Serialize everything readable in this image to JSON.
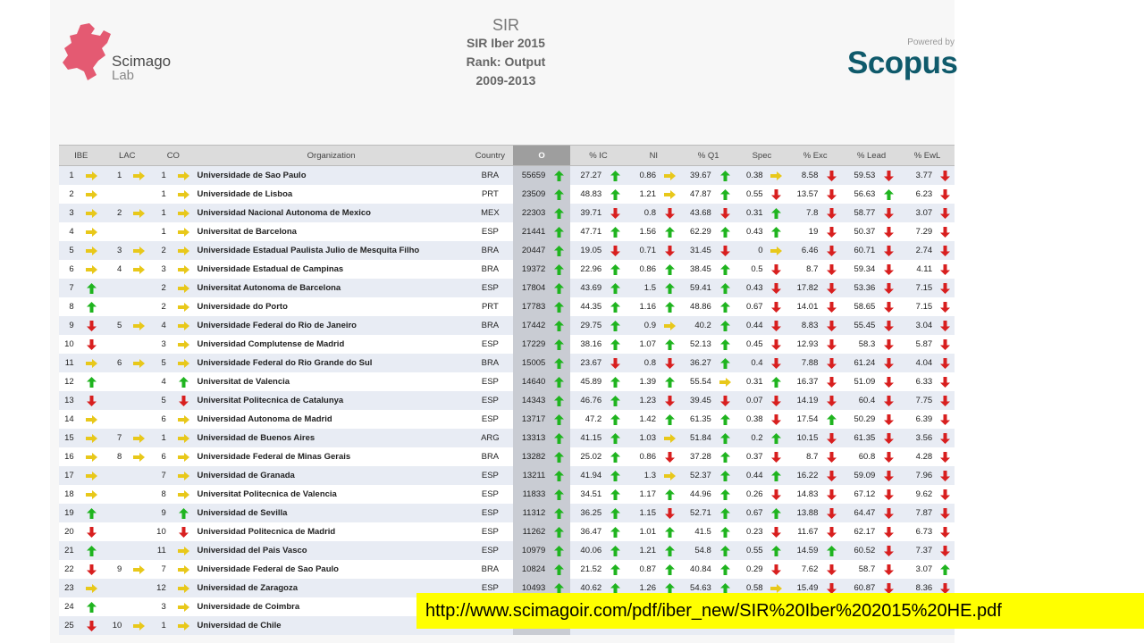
{
  "header": {
    "left_logo": {
      "brand": "Scimago",
      "sub": "Lab"
    },
    "center": {
      "sir_logo": "SIR",
      "line1": "SIR Iber 2015",
      "line2": "Rank: Output",
      "line3": "2009-2013"
    },
    "right_logo": {
      "powered_by": "Powered by",
      "brand": "Scopus"
    }
  },
  "colors": {
    "up": "#1fb41f",
    "down": "#d81f1f",
    "same": "#e8c81a",
    "scimago_pink": "#e45a72",
    "scopus_teal": "#0f5a6b"
  },
  "table": {
    "columns": [
      "IBE",
      "LAC",
      "CO",
      "Organization",
      "Country",
      "O",
      "% IC",
      "NI",
      "% Q1",
      "Spec",
      "% Exc",
      "% Lead",
      "% EwL"
    ],
    "selected_column": "O",
    "rows": [
      {
        "ibe": "1",
        "ibe_t": "same",
        "lac": "1",
        "lac_t": "same",
        "co": "1",
        "co_t": "same",
        "org": "Universidade de Sao Paulo",
        "country": "BRA",
        "o": "55659",
        "o_t": "up",
        "ic": "27.27",
        "ic_t": "up",
        "ni": "0.86",
        "ni_t": "same",
        "q1": "39.67",
        "q1_t": "up",
        "spec": "0.38",
        "spec_t": "same",
        "exc": "8.58",
        "exc_t": "down",
        "lead": "59.53",
        "lead_t": "down",
        "ewl": "3.77",
        "ewl_t": "down"
      },
      {
        "ibe": "2",
        "ibe_t": "same",
        "lac": "",
        "lac_t": "",
        "co": "1",
        "co_t": "same",
        "org": "Universidade de Lisboa",
        "country": "PRT",
        "o": "23509",
        "o_t": "up",
        "ic": "48.83",
        "ic_t": "up",
        "ni": "1.21",
        "ni_t": "same",
        "q1": "47.87",
        "q1_t": "up",
        "spec": "0.55",
        "spec_t": "down",
        "exc": "13.57",
        "exc_t": "down",
        "lead": "56.63",
        "lead_t": "up",
        "ewl": "6.23",
        "ewl_t": "down"
      },
      {
        "ibe": "3",
        "ibe_t": "same",
        "lac": "2",
        "lac_t": "same",
        "co": "1",
        "co_t": "same",
        "org": "Universidad Nacional Autonoma de Mexico",
        "country": "MEX",
        "o": "22303",
        "o_t": "up",
        "ic": "39.71",
        "ic_t": "down",
        "ni": "0.8",
        "ni_t": "down",
        "q1": "43.68",
        "q1_t": "down",
        "spec": "0.31",
        "spec_t": "up",
        "exc": "7.8",
        "exc_t": "down",
        "lead": "58.77",
        "lead_t": "down",
        "ewl": "3.07",
        "ewl_t": "down"
      },
      {
        "ibe": "4",
        "ibe_t": "same",
        "lac": "",
        "lac_t": "",
        "co": "1",
        "co_t": "same",
        "org": "Universitat de Barcelona",
        "country": "ESP",
        "o": "21441",
        "o_t": "up",
        "ic": "47.71",
        "ic_t": "up",
        "ni": "1.56",
        "ni_t": "up",
        "q1": "62.29",
        "q1_t": "up",
        "spec": "0.43",
        "spec_t": "up",
        "exc": "19",
        "exc_t": "down",
        "lead": "50.37",
        "lead_t": "down",
        "ewl": "7.29",
        "ewl_t": "down"
      },
      {
        "ibe": "5",
        "ibe_t": "same",
        "lac": "3",
        "lac_t": "same",
        "co": "2",
        "co_t": "same",
        "org": "Universidade Estadual Paulista Julio de Mesquita Filho",
        "country": "BRA",
        "o": "20447",
        "o_t": "up",
        "ic": "19.05",
        "ic_t": "down",
        "ni": "0.71",
        "ni_t": "down",
        "q1": "31.45",
        "q1_t": "down",
        "spec": "0",
        "spec_t": "same",
        "exc": "6.46",
        "exc_t": "down",
        "lead": "60.71",
        "lead_t": "down",
        "ewl": "2.74",
        "ewl_t": "down"
      },
      {
        "ibe": "6",
        "ibe_t": "same",
        "lac": "4",
        "lac_t": "same",
        "co": "3",
        "co_t": "same",
        "org": "Universidade Estadual de Campinas",
        "country": "BRA",
        "o": "19372",
        "o_t": "up",
        "ic": "22.96",
        "ic_t": "up",
        "ni": "0.86",
        "ni_t": "up",
        "q1": "38.45",
        "q1_t": "up",
        "spec": "0.5",
        "spec_t": "down",
        "exc": "8.7",
        "exc_t": "down",
        "lead": "59.34",
        "lead_t": "down",
        "ewl": "4.11",
        "ewl_t": "down"
      },
      {
        "ibe": "7",
        "ibe_t": "up",
        "lac": "",
        "lac_t": "",
        "co": "2",
        "co_t": "same",
        "org": "Universitat Autonoma de Barcelona",
        "country": "ESP",
        "o": "17804",
        "o_t": "up",
        "ic": "43.69",
        "ic_t": "up",
        "ni": "1.5",
        "ni_t": "up",
        "q1": "59.41",
        "q1_t": "up",
        "spec": "0.43",
        "spec_t": "down",
        "exc": "17.82",
        "exc_t": "down",
        "lead": "53.36",
        "lead_t": "down",
        "ewl": "7.15",
        "ewl_t": "down"
      },
      {
        "ibe": "8",
        "ibe_t": "up",
        "lac": "",
        "lac_t": "",
        "co": "2",
        "co_t": "same",
        "org": "Universidade do Porto",
        "country": "PRT",
        "o": "17783",
        "o_t": "up",
        "ic": "44.35",
        "ic_t": "up",
        "ni": "1.16",
        "ni_t": "up",
        "q1": "48.86",
        "q1_t": "up",
        "spec": "0.67",
        "spec_t": "down",
        "exc": "14.01",
        "exc_t": "down",
        "lead": "58.65",
        "lead_t": "down",
        "ewl": "7.15",
        "ewl_t": "down"
      },
      {
        "ibe": "9",
        "ibe_t": "down",
        "lac": "5",
        "lac_t": "same",
        "co": "4",
        "co_t": "same",
        "org": "Universidade Federal do Rio de Janeiro",
        "country": "BRA",
        "o": "17442",
        "o_t": "up",
        "ic": "29.75",
        "ic_t": "up",
        "ni": "0.9",
        "ni_t": "same",
        "q1": "40.2",
        "q1_t": "up",
        "spec": "0.44",
        "spec_t": "down",
        "exc": "8.83",
        "exc_t": "down",
        "lead": "55.45",
        "lead_t": "down",
        "ewl": "3.04",
        "ewl_t": "down"
      },
      {
        "ibe": "10",
        "ibe_t": "down",
        "lac": "",
        "lac_t": "",
        "co": "3",
        "co_t": "same",
        "org": "Universidad Complutense de Madrid",
        "country": "ESP",
        "o": "17229",
        "o_t": "up",
        "ic": "38.16",
        "ic_t": "up",
        "ni": "1.07",
        "ni_t": "up",
        "q1": "52.13",
        "q1_t": "up",
        "spec": "0.45",
        "spec_t": "down",
        "exc": "12.93",
        "exc_t": "down",
        "lead": "58.3",
        "lead_t": "down",
        "ewl": "5.87",
        "ewl_t": "down"
      },
      {
        "ibe": "11",
        "ibe_t": "same",
        "lac": "6",
        "lac_t": "same",
        "co": "5",
        "co_t": "same",
        "org": "Universidade Federal do Rio Grande do Sul",
        "country": "BRA",
        "o": "15005",
        "o_t": "up",
        "ic": "23.67",
        "ic_t": "down",
        "ni": "0.8",
        "ni_t": "down",
        "q1": "36.27",
        "q1_t": "up",
        "spec": "0.4",
        "spec_t": "down",
        "exc": "7.88",
        "exc_t": "down",
        "lead": "61.24",
        "lead_t": "down",
        "ewl": "4.04",
        "ewl_t": "down"
      },
      {
        "ibe": "12",
        "ibe_t": "up",
        "lac": "",
        "lac_t": "",
        "co": "4",
        "co_t": "up",
        "org": "Universitat de Valencia",
        "country": "ESP",
        "o": "14640",
        "o_t": "up",
        "ic": "45.89",
        "ic_t": "up",
        "ni": "1.39",
        "ni_t": "up",
        "q1": "55.54",
        "q1_t": "same",
        "spec": "0.31",
        "spec_t": "up",
        "exc": "16.37",
        "exc_t": "down",
        "lead": "51.09",
        "lead_t": "down",
        "ewl": "6.33",
        "ewl_t": "down"
      },
      {
        "ibe": "13",
        "ibe_t": "down",
        "lac": "",
        "lac_t": "",
        "co": "5",
        "co_t": "down",
        "org": "Universitat Politecnica de Catalunya",
        "country": "ESP",
        "o": "14343",
        "o_t": "up",
        "ic": "46.76",
        "ic_t": "up",
        "ni": "1.23",
        "ni_t": "down",
        "q1": "39.45",
        "q1_t": "down",
        "spec": "0.07",
        "spec_t": "down",
        "exc": "14.19",
        "exc_t": "down",
        "lead": "60.4",
        "lead_t": "down",
        "ewl": "7.75",
        "ewl_t": "down"
      },
      {
        "ibe": "14",
        "ibe_t": "same",
        "lac": "",
        "lac_t": "",
        "co": "6",
        "co_t": "same",
        "org": "Universidad Autonoma de Madrid",
        "country": "ESP",
        "o": "13717",
        "o_t": "up",
        "ic": "47.2",
        "ic_t": "up",
        "ni": "1.42",
        "ni_t": "up",
        "q1": "61.35",
        "q1_t": "up",
        "spec": "0.38",
        "spec_t": "down",
        "exc": "17.54",
        "exc_t": "up",
        "lead": "50.29",
        "lead_t": "down",
        "ewl": "6.39",
        "ewl_t": "down"
      },
      {
        "ibe": "15",
        "ibe_t": "same",
        "lac": "7",
        "lac_t": "same",
        "co": "1",
        "co_t": "same",
        "org": "Universidad de Buenos Aires",
        "country": "ARG",
        "o": "13313",
        "o_t": "up",
        "ic": "41.15",
        "ic_t": "up",
        "ni": "1.03",
        "ni_t": "same",
        "q1": "51.84",
        "q1_t": "up",
        "spec": "0.2",
        "spec_t": "up",
        "exc": "10.15",
        "exc_t": "down",
        "lead": "61.35",
        "lead_t": "down",
        "ewl": "3.56",
        "ewl_t": "down"
      },
      {
        "ibe": "16",
        "ibe_t": "same",
        "lac": "8",
        "lac_t": "same",
        "co": "6",
        "co_t": "same",
        "org": "Universidade Federal de Minas Gerais",
        "country": "BRA",
        "o": "13282",
        "o_t": "up",
        "ic": "25.02",
        "ic_t": "up",
        "ni": "0.86",
        "ni_t": "down",
        "q1": "37.28",
        "q1_t": "up",
        "spec": "0.37",
        "spec_t": "down",
        "exc": "8.7",
        "exc_t": "down",
        "lead": "60.8",
        "lead_t": "down",
        "ewl": "4.28",
        "ewl_t": "down"
      },
      {
        "ibe": "17",
        "ibe_t": "same",
        "lac": "",
        "lac_t": "",
        "co": "7",
        "co_t": "same",
        "org": "Universidad de Granada",
        "country": "ESP",
        "o": "13211",
        "o_t": "up",
        "ic": "41.94",
        "ic_t": "up",
        "ni": "1.3",
        "ni_t": "same",
        "q1": "52.37",
        "q1_t": "up",
        "spec": "0.44",
        "spec_t": "up",
        "exc": "16.22",
        "exc_t": "down",
        "lead": "59.09",
        "lead_t": "down",
        "ewl": "7.96",
        "ewl_t": "down"
      },
      {
        "ibe": "18",
        "ibe_t": "same",
        "lac": "",
        "lac_t": "",
        "co": "8",
        "co_t": "same",
        "org": "Universitat Politecnica de Valencia",
        "country": "ESP",
        "o": "11833",
        "o_t": "up",
        "ic": "34.51",
        "ic_t": "up",
        "ni": "1.17",
        "ni_t": "up",
        "q1": "44.96",
        "q1_t": "up",
        "spec": "0.26",
        "spec_t": "down",
        "exc": "14.83",
        "exc_t": "down",
        "lead": "67.12",
        "lead_t": "down",
        "ewl": "9.62",
        "ewl_t": "down"
      },
      {
        "ibe": "19",
        "ibe_t": "up",
        "lac": "",
        "lac_t": "",
        "co": "9",
        "co_t": "up",
        "org": "Universidad de Sevilla",
        "country": "ESP",
        "o": "11312",
        "o_t": "up",
        "ic": "36.25",
        "ic_t": "up",
        "ni": "1.15",
        "ni_t": "down",
        "q1": "52.71",
        "q1_t": "up",
        "spec": "0.67",
        "spec_t": "up",
        "exc": "13.88",
        "exc_t": "down",
        "lead": "64.47",
        "lead_t": "down",
        "ewl": "7.87",
        "ewl_t": "down"
      },
      {
        "ibe": "20",
        "ibe_t": "down",
        "lac": "",
        "lac_t": "",
        "co": "10",
        "co_t": "down",
        "org": "Universidad Politecnica de Madrid",
        "country": "ESP",
        "o": "11262",
        "o_t": "up",
        "ic": "36.47",
        "ic_t": "up",
        "ni": "1.01",
        "ni_t": "up",
        "q1": "41.5",
        "q1_t": "up",
        "spec": "0.23",
        "spec_t": "down",
        "exc": "11.67",
        "exc_t": "down",
        "lead": "62.17",
        "lead_t": "down",
        "ewl": "6.73",
        "ewl_t": "down"
      },
      {
        "ibe": "21",
        "ibe_t": "up",
        "lac": "",
        "lac_t": "",
        "co": "11",
        "co_t": "same",
        "org": "Universidad del Pais Vasco",
        "country": "ESP",
        "o": "10979",
        "o_t": "up",
        "ic": "40.06",
        "ic_t": "up",
        "ni": "1.21",
        "ni_t": "up",
        "q1": "54.8",
        "q1_t": "up",
        "spec": "0.55",
        "spec_t": "up",
        "exc": "14.59",
        "exc_t": "up",
        "lead": "60.52",
        "lead_t": "down",
        "ewl": "7.37",
        "ewl_t": "down"
      },
      {
        "ibe": "22",
        "ibe_t": "down",
        "lac": "9",
        "lac_t": "same",
        "co": "7",
        "co_t": "same",
        "org": "Universidade Federal de Sao Paulo",
        "country": "BRA",
        "o": "10824",
        "o_t": "up",
        "ic": "21.52",
        "ic_t": "up",
        "ni": "0.87",
        "ni_t": "up",
        "q1": "40.84",
        "q1_t": "up",
        "spec": "0.29",
        "spec_t": "down",
        "exc": "7.62",
        "exc_t": "down",
        "lead": "58.7",
        "lead_t": "down",
        "ewl": "3.07",
        "ewl_t": "up"
      },
      {
        "ibe": "23",
        "ibe_t": "same",
        "lac": "",
        "lac_t": "",
        "co": "12",
        "co_t": "same",
        "org": "Universidad de Zaragoza",
        "country": "ESP",
        "o": "10493",
        "o_t": "up",
        "ic": "40.62",
        "ic_t": "up",
        "ni": "1.26",
        "ni_t": "up",
        "q1": "54.63",
        "q1_t": "up",
        "spec": "0.58",
        "spec_t": "same",
        "exc": "15.49",
        "exc_t": "down",
        "lead": "60.87",
        "lead_t": "down",
        "ewl": "8.36",
        "ewl_t": "down"
      },
      {
        "ibe": "24",
        "ibe_t": "up",
        "lac": "",
        "lac_t": "",
        "co": "3",
        "co_t": "same",
        "org": "Universidade de Coimbra",
        "country": "",
        "o": "",
        "o_t": "",
        "ic": "",
        "ic_t": "",
        "ni": "",
        "ni_t": "",
        "q1": "",
        "q1_t": "",
        "spec": "",
        "spec_t": "",
        "exc": "",
        "exc_t": "",
        "lead": "",
        "lead_t": "",
        "ewl": "",
        "ewl_t": ""
      },
      {
        "ibe": "25",
        "ibe_t": "down",
        "lac": "10",
        "lac_t": "same",
        "co": "1",
        "co_t": "same",
        "org": "Universidad de Chile",
        "country": "",
        "o": "",
        "o_t": "",
        "ic": "",
        "ic_t": "",
        "ni": "",
        "ni_t": "",
        "q1": "",
        "q1_t": "",
        "spec": "",
        "spec_t": "",
        "exc": "",
        "exc_t": "",
        "lead": "",
        "lead_t": "",
        "ewl": "",
        "ewl_t": ""
      }
    ]
  },
  "banner": {
    "url": "http://www.scimagoir.com/pdf/iber_new/SIR%20Iber%202015%20HE.pdf"
  }
}
